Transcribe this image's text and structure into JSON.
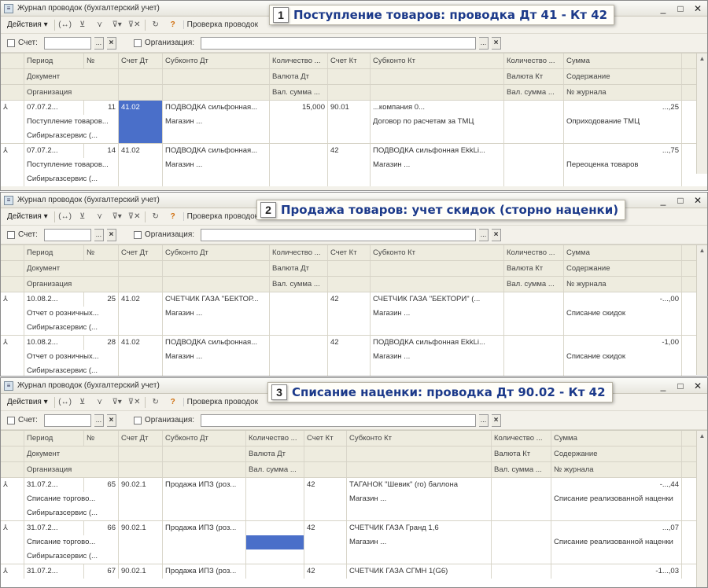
{
  "callouts": [
    {
      "num": "1",
      "text": "Поступление товаров: проводка Дт 41 - Кт 42"
    },
    {
      "num": "2",
      "text": "Продажа товаров: учет скидок (сторно наценки)"
    },
    {
      "num": "3",
      "text": "Списание наценки: проводка Дт 90.02 - Кт 42"
    }
  ],
  "window": {
    "title": "Журнал проводок (бухгалтерский учет)",
    "actions_menu": "Действия",
    "toolbar_text": "Проверка проводок",
    "filter_account": "Счет:",
    "filter_org": "Организация:",
    "controls": {
      "minimize": "_",
      "maximize": "□",
      "close": "✕"
    }
  },
  "headers": {
    "row1": [
      "Период",
      "№",
      "Счет Дт",
      "Субконто Дт",
      "Количество ...",
      "Счет Кт",
      "Субконто Кт",
      "Количество ...",
      "Сумма"
    ],
    "row2": [
      "Документ",
      "",
      "",
      "Валюта Дт",
      "",
      "",
      "Валюта Кт",
      "Содержание"
    ],
    "row3": [
      "Организация",
      "",
      "",
      "Вал. сумма ...",
      "",
      "",
      "Вал. сумма ...",
      "№ журнала"
    ]
  },
  "panel1": {
    "rows": [
      {
        "l1": [
          "07.07.2...",
          "11",
          "41.02",
          "ПОДВОДКА сильфонная...",
          "15,000",
          "90.01",
          "...компания 0...",
          "",
          "...,25"
        ],
        "l2": [
          "Поступление товаров...",
          "",
          "Магазин ...",
          "",
          "",
          "Договор по расчетам за ТМЦ",
          "",
          "Оприходование ТМЦ"
        ],
        "l3": [
          "Сибирьгазсервис (...",
          "",
          "",
          "",
          "",
          "",
          "",
          ""
        ]
      },
      {
        "l1": [
          "07.07.2...",
          "14",
          "41.02",
          "ПОДВОДКА сильфонная...",
          "",
          "42",
          "ПОДВОДКА сильфонная EkkLi...",
          "",
          "...,75"
        ],
        "l2": [
          "Поступление товаров...",
          "",
          "Магазин ...",
          "",
          "",
          "Магазин ...",
          "",
          "Переоценка товаров"
        ],
        "l3": [
          "Сибирьгазсервис (...",
          "",
          "",
          "",
          "",
          "",
          "",
          ""
        ]
      }
    ]
  },
  "panel2": {
    "rows": [
      {
        "l1": [
          "10.08.2...",
          "25",
          "41.02",
          "СЧЕТЧИК ГАЗА \"БЕКТОР...",
          "",
          "42",
          "СЧЕТЧИК ГАЗА \"БЕКТОРИ\" (...",
          "",
          "-...,00"
        ],
        "l2": [
          "Отчет о розничных...",
          "",
          "Магазин ...",
          "",
          "",
          "Магазин ...",
          "",
          "Списание скидок"
        ],
        "l3": [
          "Сибирьгазсервис (...",
          "",
          "",
          "",
          "",
          "",
          "",
          ""
        ]
      },
      {
        "l1": [
          "10.08.2...",
          "28",
          "41.02",
          "ПОДВОДКА сильфонная...",
          "",
          "42",
          "ПОДВОДКА сильфонная EkkLi...",
          "",
          "-1,00"
        ],
        "l2": [
          "Отчет о розничных...",
          "",
          "Магазин ...",
          "",
          "",
          "Магазин ...",
          "",
          "Списание скидок"
        ],
        "l3": [
          "Сибирьгазсервис (...",
          "",
          "",
          "",
          "",
          "",
          "",
          ""
        ]
      }
    ]
  },
  "panel3": {
    "rows": [
      {
        "l1": [
          "31.07.2...",
          "65",
          "90.02.1",
          "Продажа ИПЗ (роз...",
          "",
          "42",
          "ТАГАНОК \"Шевик\" (го) баллона",
          "",
          "-...,44"
        ],
        "l2": [
          "Списание торгово...",
          "",
          "",
          "",
          "",
          "Магазин ...",
          "",
          "Списание реализованной наценки"
        ],
        "l3": [
          "Сибирьгазсервис (...",
          "",
          "",
          "",
          "",
          "",
          "",
          ""
        ]
      },
      {
        "l1": [
          "31.07.2...",
          "66",
          "90.02.1",
          "Продажа ИПЗ (роз...",
          "",
          "42",
          "СЧЕТЧИК ГАЗА Гранд 1,6",
          "",
          "...,07"
        ],
        "l2": [
          "Списание торгово...",
          "",
          "",
          "",
          "",
          "Магазин ...",
          "",
          "Списание реализованной наценки"
        ],
        "l3": [
          "Сибирьгазсервис (...",
          "",
          "",
          "",
          "",
          "",
          "",
          ""
        ]
      },
      {
        "l1": [
          "31.07.2...",
          "67",
          "90.02.1",
          "Продажа ИПЗ (роз...",
          "",
          "42",
          "СЧЕТЧИК ГАЗА СГМН 1(G6)",
          "",
          "-1...,03"
        ]
      }
    ]
  }
}
